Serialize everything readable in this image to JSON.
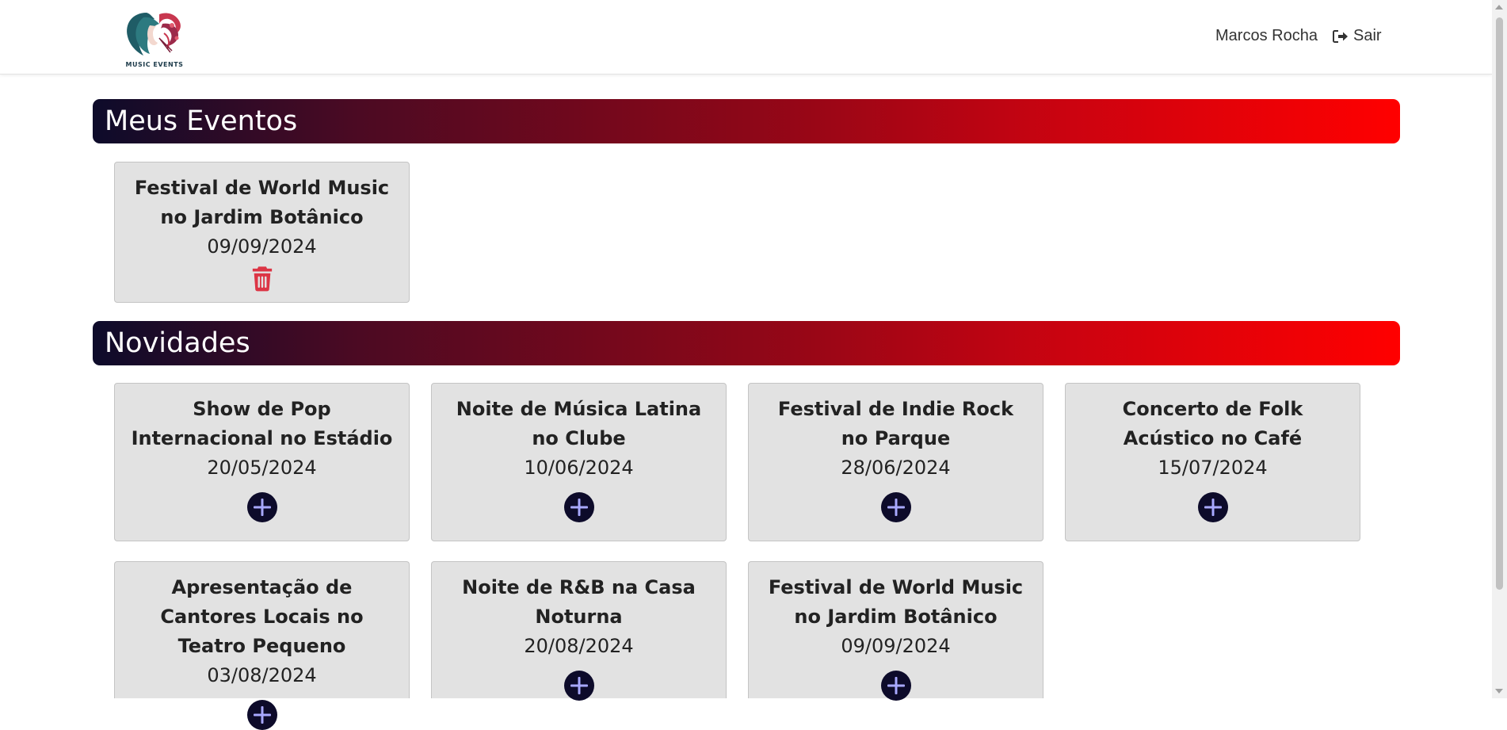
{
  "header": {
    "logo_text": "MUSIC EVENTS",
    "user_name": "Marcos Rocha",
    "logout_label": "Sair"
  },
  "my_events": {
    "title": "Meus Eventos",
    "events": [
      {
        "title": "Festival de World Music no Jardim Botânico",
        "date": "09/09/2024"
      }
    ]
  },
  "news": {
    "title": "Novidades",
    "events": [
      {
        "title": "Show de Pop Internacional no Estádio",
        "date": "20/05/2024"
      },
      {
        "title": "Noite de Música Latina no Clube",
        "date": "10/06/2024"
      },
      {
        "title": "Festival de Indie Rock no Parque",
        "date": "28/06/2024"
      },
      {
        "title": "Concerto de Folk Acústico no Café",
        "date": "15/07/2024"
      },
      {
        "title": "Apresentação de Cantores Locais no Teatro Pequeno",
        "date": "03/08/2024"
      },
      {
        "title": "Noite de R&B na Casa Noturna",
        "date": "20/08/2024"
      },
      {
        "title": "Festival de World Music no Jardim Botânico",
        "date": "09/09/2024"
      }
    ]
  },
  "colors": {
    "banner_start": "#0d0b2a",
    "banner_end": "#ff0000",
    "card_bg": "#e2e2e2",
    "trash_icon": "#dc3545",
    "add_button_bg": "#0d0b2a",
    "add_button_plus": "#a8a8ff"
  }
}
